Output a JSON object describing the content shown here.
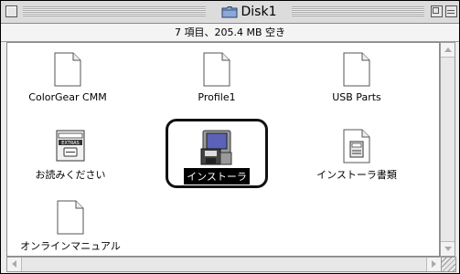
{
  "window": {
    "title": "Disk1",
    "title_icon": "folder-icon"
  },
  "infobar": {
    "text": "7 項目、205.4 MB 空き"
  },
  "items": [
    {
      "label": "ColorGear CMM",
      "icon": "document-icon",
      "selected": false
    },
    {
      "label": "Profile1",
      "icon": "document-icon",
      "selected": false
    },
    {
      "label": "USB Parts",
      "icon": "document-icon",
      "selected": false
    },
    {
      "label": "お読みください",
      "icon": "readme-icon",
      "icon_text": "EXTRAS",
      "selected": false
    },
    {
      "label": "インストーラ",
      "icon": "installer-icon",
      "selected": true
    },
    {
      "label": "インストーラ書類",
      "icon": "installer-document-icon",
      "selected": false
    },
    {
      "label": "オンラインマニュアル",
      "icon": "document-icon",
      "selected": false
    }
  ],
  "colors": {
    "selection_bg": "#000000",
    "selection_text": "#ffffff",
    "installer_screen": "#5b62b8"
  }
}
